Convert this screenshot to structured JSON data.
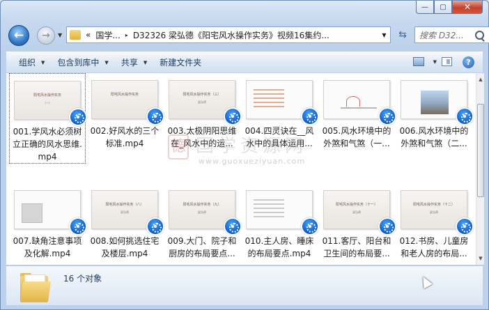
{
  "window": {
    "caption_buttons": {
      "minimize": "—",
      "maximize": "▢",
      "close": "✕"
    }
  },
  "navigation": {
    "back_icon": "back-arrow-icon",
    "forward_icon": "forward-arrow-icon",
    "address": {
      "overflow": "«",
      "parts": [
        "国学...",
        "D32326 梁弘德《阳宅风水操作实务》视频16集约..."
      ],
      "separator": "▸"
    },
    "search_placeholder": "搜索 D32..."
  },
  "toolbar": {
    "organize": "组织",
    "include_in_library": "包含到库中",
    "share": "共享",
    "new_folder": "新建文件夹"
  },
  "files": [
    {
      "name": "001.学风水必须树立正确的风水思维.mp4",
      "thumb_title": "阳宅风水操作实务",
      "thumb_sub": "(一)",
      "kind": "title"
    },
    {
      "name": "002.好风水的三个标准.mp4",
      "thumb_title": "阳宅风水操作实务",
      "thumb_sub": "",
      "kind": "title"
    },
    {
      "name": "003.太极阴阳思维在_风水中的运...",
      "thumb_title": "阳宅风水操作实务（三）",
      "thumb_sub": "梁弘德",
      "kind": "title"
    },
    {
      "name": "004.四灵诀在__风水中的具体运用...",
      "thumb_title": "",
      "thumb_sub": "",
      "kind": "list"
    },
    {
      "name": "005.风水环境中的外煞和气煞（一...",
      "thumb_title": "",
      "thumb_sub": "",
      "kind": "diagram"
    },
    {
      "name": "006.风水环境中的外煞和气煞（二...",
      "thumb_title": "",
      "thumb_sub": "",
      "kind": "photo"
    },
    {
      "name": "007.缺角注意事项及化解.mp4",
      "thumb_title": "",
      "thumb_sub": "",
      "kind": "image-list"
    },
    {
      "name": "008.如何挑选住宅及楼层.mp4",
      "thumb_title": "阳宅风水操作实务（八）",
      "thumb_sub": "梁弘德",
      "kind": "title"
    },
    {
      "name": "009.大门、院子和厨房的布局要点...",
      "thumb_title": "阳宅风水操作实务（九）",
      "thumb_sub": "梁弘德",
      "kind": "title"
    },
    {
      "name": "010.主人房、睡床的布局要点.mp4",
      "thumb_title": "",
      "thumb_sub": "",
      "kind": "list"
    },
    {
      "name": "011.客厅、阳台和卫生间的布局要...",
      "thumb_title": "阳宅风水操作实务（十一）",
      "thumb_sub": "梁弘德",
      "kind": "title"
    },
    {
      "name": "012.书房、儿童房和老人房的布局...",
      "thumb_title": "阳宅风水操作实务（十二）",
      "thumb_sub": "梁弘德",
      "kind": "title"
    }
  ],
  "watermark": {
    "seal": "德",
    "title": "国学资源网",
    "url": "www.guoxueziyuan.com"
  },
  "status": {
    "count_text": "16 个对象"
  }
}
